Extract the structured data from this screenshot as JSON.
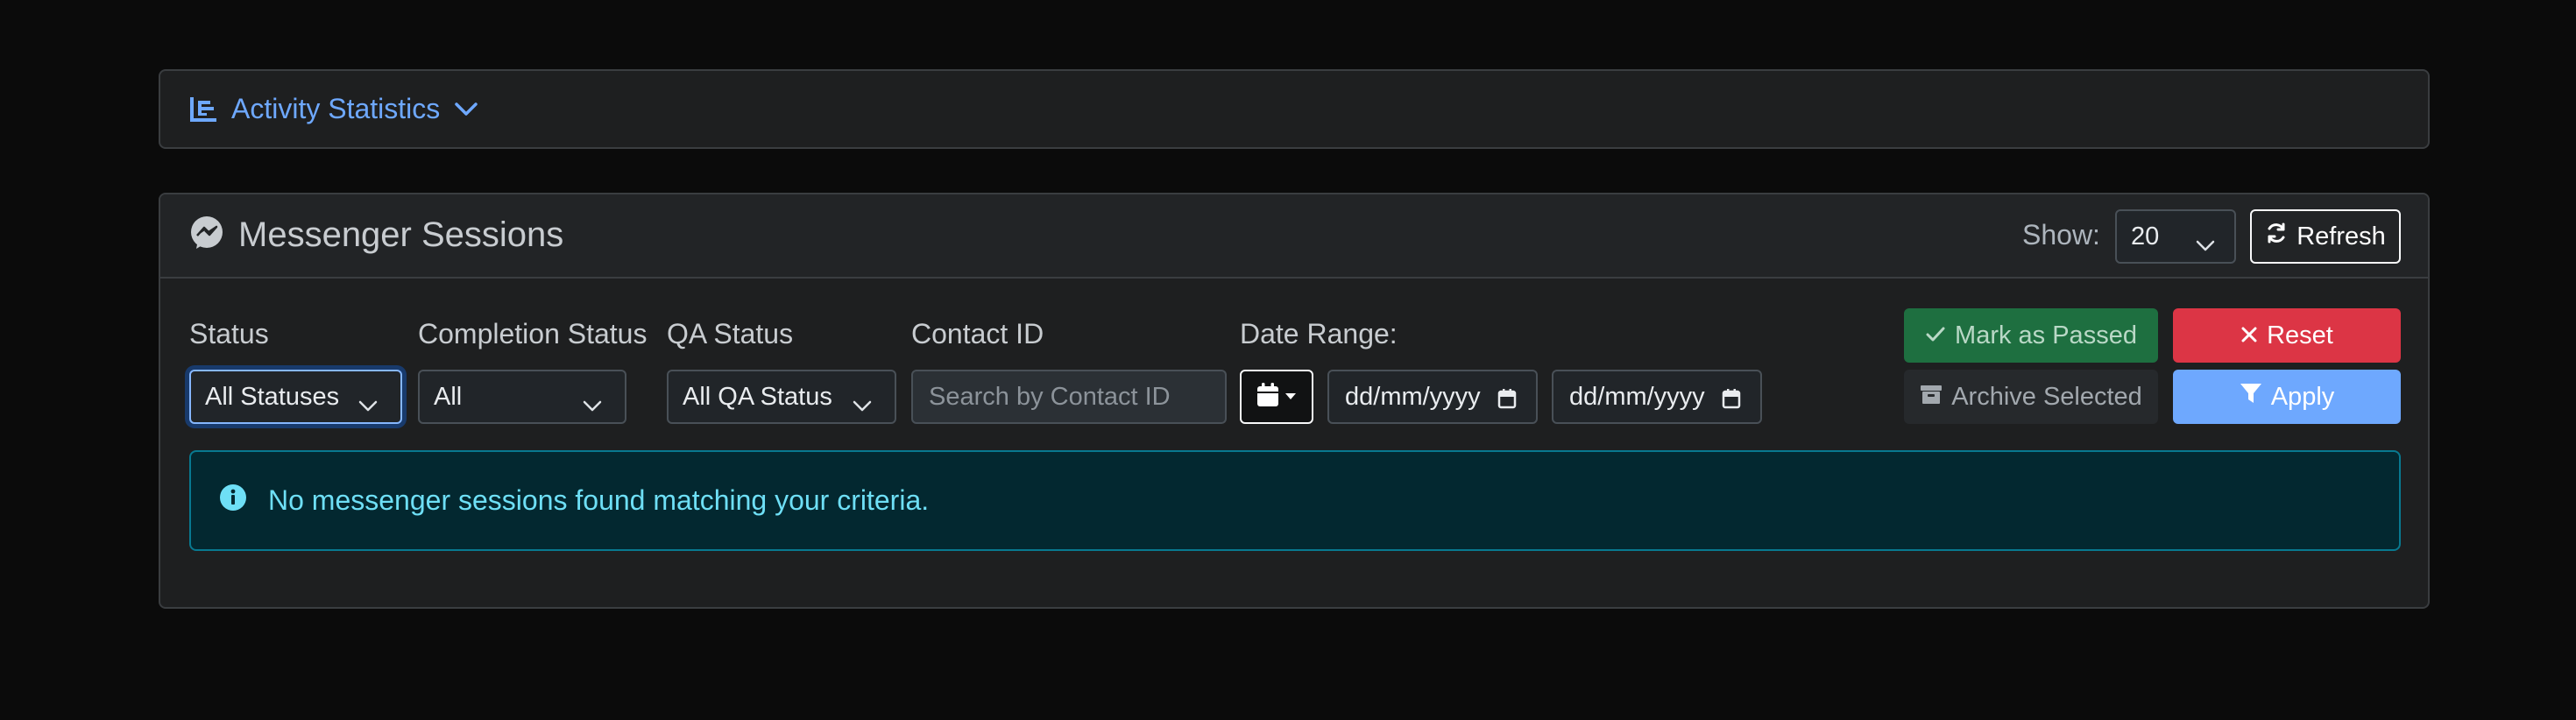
{
  "activity": {
    "title": "Activity Statistics",
    "icon": "chart-bar-icon",
    "toggle_icon": "chevron-down-icon"
  },
  "sessions": {
    "title": "Messenger Sessions",
    "icon": "messenger-icon",
    "show_label": "Show:",
    "show_value": "20",
    "refresh_label": "Refresh"
  },
  "filters": {
    "status": {
      "label": "Status",
      "value": "All Statuses"
    },
    "completion": {
      "label": "Completion Status",
      "value": "All"
    },
    "qa": {
      "label": "QA Status",
      "value": "All QA Status"
    },
    "contact": {
      "label": "Contact ID",
      "placeholder": "Search by Contact ID"
    },
    "date": {
      "label": "Date Range:",
      "from_placeholder": "dd/mm/yyyy",
      "to_placeholder": "dd/mm/yyyy"
    }
  },
  "actions": {
    "mark_passed": "Mark as Passed",
    "reset": "Reset",
    "archive": "Archive Selected",
    "apply": "Apply"
  },
  "alert": {
    "message": "No messenger sessions found matching your criteria."
  },
  "colors": {
    "accent": "#6ea8fe",
    "success": "#1e6f40",
    "danger": "#dc3545",
    "info_text": "#6edff6"
  }
}
